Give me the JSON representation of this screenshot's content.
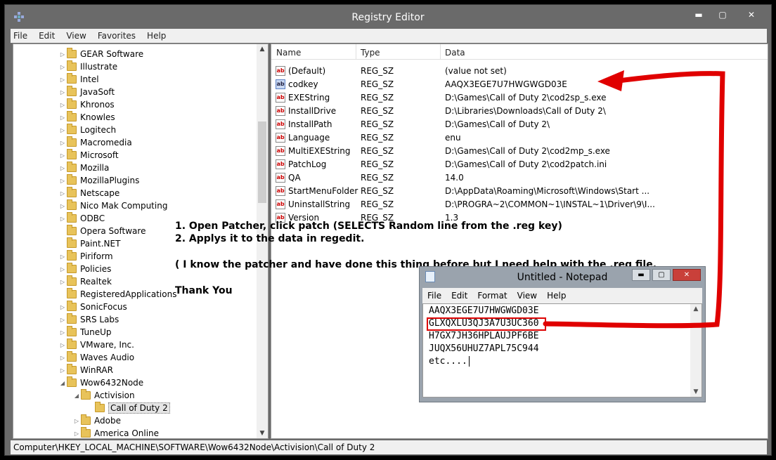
{
  "window": {
    "title": "Registry Editor",
    "min_glyph": "▬",
    "max_glyph": "▢",
    "close_glyph": "✕"
  },
  "menu": [
    "File",
    "Edit",
    "View",
    "Favorites",
    "Help"
  ],
  "tree": {
    "items": [
      {
        "label": "GEAR Software",
        "expander": "▷"
      },
      {
        "label": "Illustrate",
        "expander": "▷"
      },
      {
        "label": "Intel",
        "expander": "▷"
      },
      {
        "label": "JavaSoft",
        "expander": "▷"
      },
      {
        "label": "Khronos",
        "expander": "▷"
      },
      {
        "label": "Knowles",
        "expander": "▷"
      },
      {
        "label": "Logitech",
        "expander": "▷"
      },
      {
        "label": "Macromedia",
        "expander": "▷"
      },
      {
        "label": "Microsoft",
        "expander": "▷"
      },
      {
        "label": "Mozilla",
        "expander": "▷"
      },
      {
        "label": "MozillaPlugins",
        "expander": "▷"
      },
      {
        "label": "Netscape",
        "expander": "▷"
      },
      {
        "label": "Nico Mak Computing",
        "expander": "▷"
      },
      {
        "label": "ODBC",
        "expander": "▷"
      },
      {
        "label": "Opera Software",
        "expander": ""
      },
      {
        "label": "Paint.NET",
        "expander": ""
      },
      {
        "label": "Piriform",
        "expander": "▷"
      },
      {
        "label": "Policies",
        "expander": "▷"
      },
      {
        "label": "Realtek",
        "expander": "▷"
      },
      {
        "label": "RegisteredApplications",
        "expander": ""
      },
      {
        "label": "SonicFocus",
        "expander": "▷"
      },
      {
        "label": "SRS Labs",
        "expander": "▷"
      },
      {
        "label": "TuneUp",
        "expander": "▷"
      },
      {
        "label": "VMware, Inc.",
        "expander": "▷"
      },
      {
        "label": "Waves Audio",
        "expander": "▷"
      },
      {
        "label": "WinRAR",
        "expander": "▷"
      },
      {
        "label": "Wow6432Node",
        "expander": "◢"
      },
      {
        "label": "Activision",
        "expander": "◢"
      },
      {
        "label": "Call of Duty 2",
        "expander": ""
      },
      {
        "label": "Adobe",
        "expander": "▷"
      },
      {
        "label": "America Online",
        "expander": "▷"
      }
    ],
    "scroll_up": "▲",
    "scroll_down": "▼"
  },
  "list": {
    "headers": {
      "name": "Name",
      "type": "Type",
      "data": "Data"
    },
    "icon_text": "ab",
    "rows": [
      {
        "name": "(Default)",
        "type": "REG_SZ",
        "data": "(value not set)"
      },
      {
        "name": "codkey",
        "type": "REG_SZ",
        "data": "AAQX3EGE7U7HWGWGD03E"
      },
      {
        "name": "EXEString",
        "type": "REG_SZ",
        "data": "D:\\Games\\Call of Duty 2\\cod2sp_s.exe"
      },
      {
        "name": "InstallDrive",
        "type": "REG_SZ",
        "data": "D:\\Libraries\\Downloads\\Call of Duty 2\\"
      },
      {
        "name": "InstallPath",
        "type": "REG_SZ",
        "data": "D:\\Games\\Call of Duty 2\\"
      },
      {
        "name": "Language",
        "type": "REG_SZ",
        "data": "enu"
      },
      {
        "name": "MultiEXEString",
        "type": "REG_SZ",
        "data": "D:\\Games\\Call of Duty 2\\cod2mp_s.exe"
      },
      {
        "name": "PatchLog",
        "type": "REG_SZ",
        "data": "D:\\Games\\Call of Duty 2\\cod2patch.ini"
      },
      {
        "name": "QA",
        "type": "REG_SZ",
        "data": "14.0"
      },
      {
        "name": "StartMenuFolder",
        "type": "REG_SZ",
        "data": "D:\\AppData\\Roaming\\Microsoft\\Windows\\Start ..."
      },
      {
        "name": "UninstallString",
        "type": "REG_SZ",
        "data": "D:\\PROGRA~2\\COMMON~1\\INSTAL~1\\Driver\\9\\I..."
      },
      {
        "name": "Version",
        "type": "REG_SZ",
        "data": "1.3"
      }
    ]
  },
  "status": "Computer\\HKEY_LOCAL_MACHINE\\SOFTWARE\\Wow6432Node\\Activision\\Call of Duty 2",
  "annotations": [
    "1. Open Patcher, click patch (SELECTS Random line from the .reg key)",
    "2. Applys it to the data in regedit.",
    "( I know the patcher and have done this thing before but I need help with the .reg file,",
    "Thank You"
  ],
  "notepad": {
    "title": "Untitled - Notepad",
    "menu": [
      "File",
      "Edit",
      "Format",
      "View",
      "Help"
    ],
    "lines": [
      "AAQX3EGE7U7HWGWGD03E",
      "GLXQXLU3QJ3A7U3UC360",
      "H7GX7JH36HPLAUJPF6BE",
      "JUQX56UHUZ7APL75C944",
      "etc...."
    ],
    "min_glyph": "▬",
    "max_glyph": "▢",
    "close_glyph": "✕",
    "scroll_up": "▲",
    "scroll_down": "▼"
  },
  "colors": {
    "annotation_red": "#e00000"
  }
}
